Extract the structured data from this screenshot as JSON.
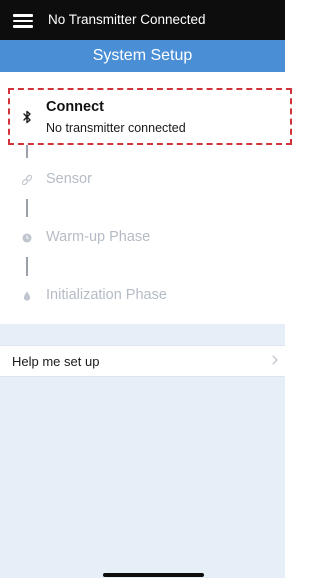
{
  "status_bar": {
    "text": "No Transmitter Connected"
  },
  "nav": {
    "title": "System Setup"
  },
  "steps": [
    {
      "label": "Connect",
      "subtitle": "No transmitter connected",
      "icon": "bluetooth-icon",
      "active": true
    },
    {
      "label": "Sensor",
      "icon": "sensor-link-icon",
      "active": false
    },
    {
      "label": "Warm-up Phase",
      "icon": "clock-icon",
      "active": false
    },
    {
      "label": "Initialization Phase",
      "icon": "drop-icon",
      "active": false
    }
  ],
  "help": {
    "label": "Help me set up"
  },
  "colors": {
    "status_bar_bg": "#0d0d0d",
    "nav_bg": "#4a8fd6",
    "highlight": "#d0343a",
    "inactive_text": "#b5bcc5",
    "page_bg": "#e6eef8"
  }
}
